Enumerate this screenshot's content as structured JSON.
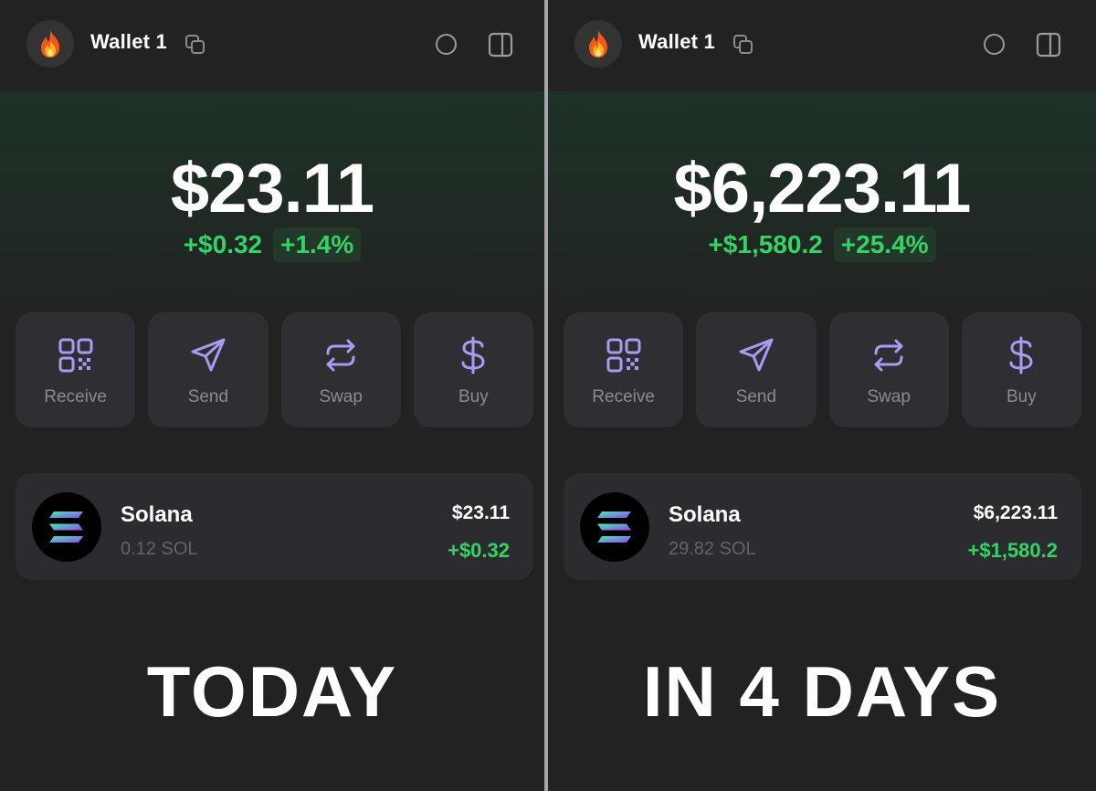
{
  "panels": [
    {
      "wallet_name": "Wallet 1",
      "balance": "$23.11",
      "change_abs": "+$0.32",
      "change_pct": "+1.4%",
      "actions": [
        {
          "label": "Receive",
          "icon": "qr-code-icon"
        },
        {
          "label": "Send",
          "icon": "paper-plane-icon"
        },
        {
          "label": "Swap",
          "icon": "swap-arrows-icon"
        },
        {
          "label": "Buy",
          "icon": "dollar-icon"
        }
      ],
      "token": {
        "name": "Solana",
        "amount": "0.12 SOL",
        "value": "$23.11",
        "change": "+$0.32",
        "icon": "solana-logo-icon"
      },
      "caption": "TODAY"
    },
    {
      "wallet_name": "Wallet 1",
      "balance": "$6,223.11",
      "change_abs": "+$1,580.2",
      "change_pct": "+25.4%",
      "actions": [
        {
          "label": "Receive",
          "icon": "qr-code-icon"
        },
        {
          "label": "Send",
          "icon": "paper-plane-icon"
        },
        {
          "label": "Swap",
          "icon": "swap-arrows-icon"
        },
        {
          "label": "Buy",
          "icon": "dollar-icon"
        }
      ],
      "token": {
        "name": "Solana",
        "amount": "29.82 SOL",
        "value": "$6,223.11",
        "change": "+$1,580.2",
        "icon": "solana-logo-icon"
      },
      "caption": "IN 4 DAYS"
    }
  ],
  "colors": {
    "background": "#222222",
    "card": "#2f2f33",
    "accent_purple": "#a99af2",
    "positive_green": "#33d466",
    "divider": "#a6a6a6"
  },
  "avatar_icon": "fire-icon"
}
